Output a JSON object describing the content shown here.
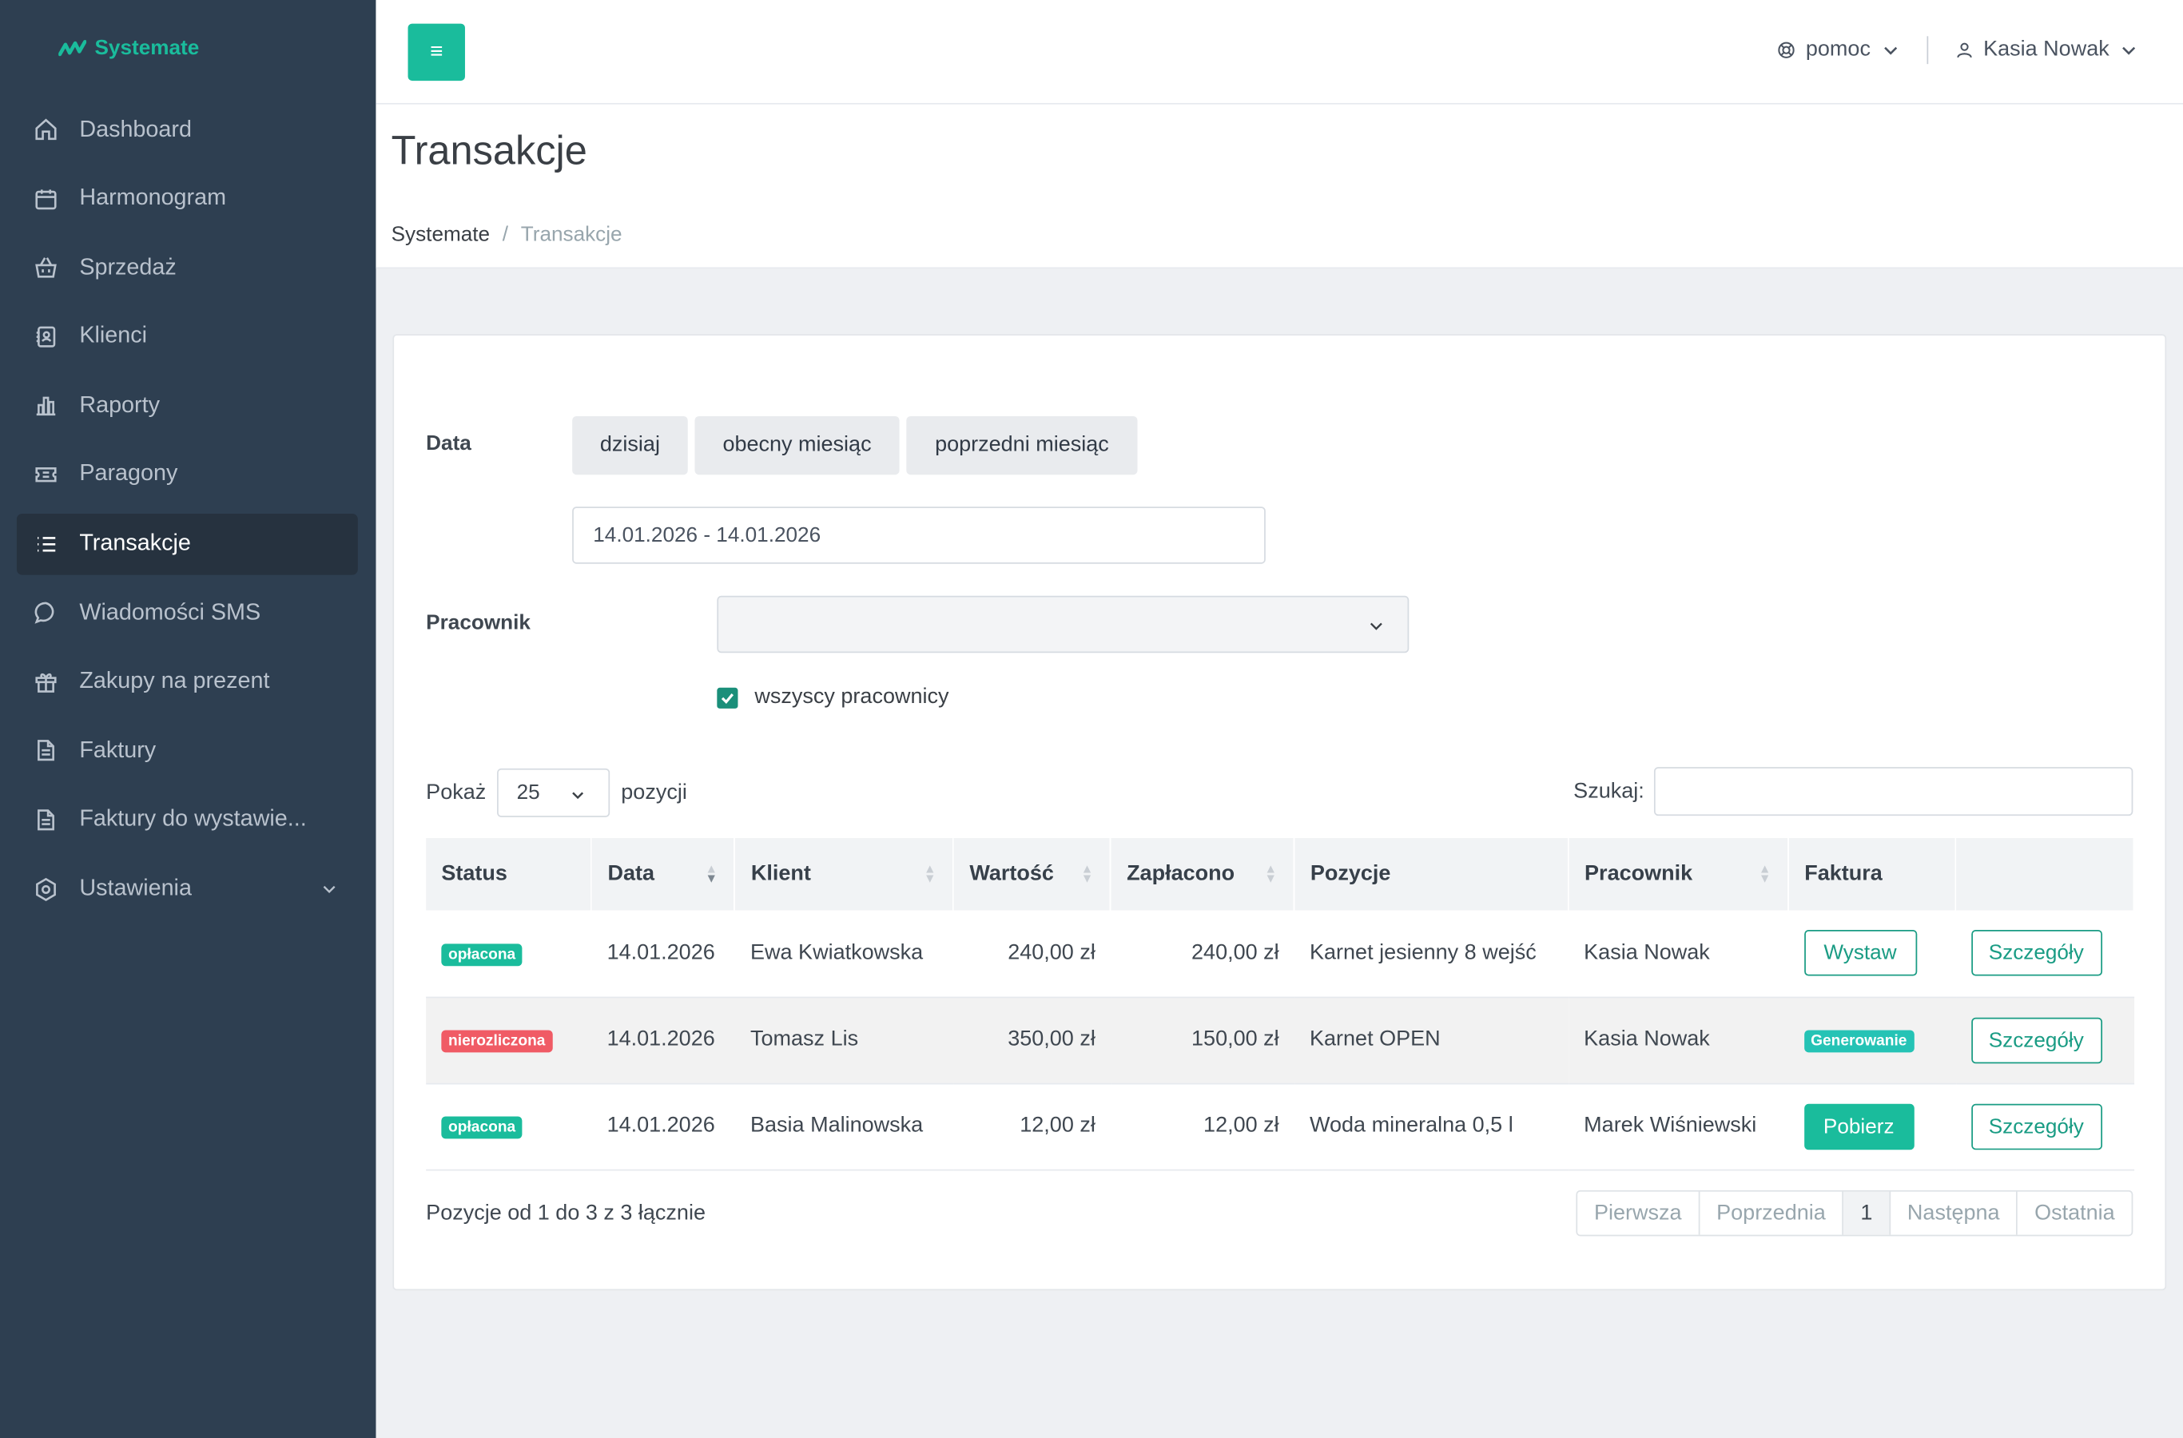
{
  "app": {
    "name": "Systemate"
  },
  "sidebar": {
    "items": [
      {
        "label": "Dashboard",
        "icon": "home-icon"
      },
      {
        "label": "Harmonogram",
        "icon": "calendar-icon"
      },
      {
        "label": "Sprzedaż",
        "icon": "basket-icon"
      },
      {
        "label": "Klienci",
        "icon": "contacts-icon"
      },
      {
        "label": "Raporty",
        "icon": "bar-chart-icon"
      },
      {
        "label": "Paragony",
        "icon": "ticket-icon"
      },
      {
        "label": "Transakcje",
        "icon": "list-icon",
        "active": true
      },
      {
        "label": "Wiadomości SMS",
        "icon": "chat-icon"
      },
      {
        "label": "Zakupy na prezent",
        "icon": "gift-icon"
      },
      {
        "label": "Faktury",
        "icon": "document-icon"
      },
      {
        "label": "Faktury do wystawie...",
        "icon": "document-icon"
      },
      {
        "label": "Ustawienia",
        "icon": "settings-icon"
      }
    ]
  },
  "topbar": {
    "menu_glyph": "≡",
    "help_label": "pomoc",
    "user_name": "Kasia Nowak"
  },
  "page": {
    "title": "Transakcje",
    "breadcrumb": {
      "root": "Systemate",
      "divider": "/",
      "current": "Transakcje"
    }
  },
  "filters": {
    "date_label": "Data",
    "quick_ranges": [
      "dzisiaj",
      "obecny miesiąc",
      "poprzedni miesiąc"
    ],
    "date_range": "14.01.2026 - 14.01.2026",
    "employee_label": "Pracownik",
    "employee_value": "",
    "all_employees_label": "wszyscy pracownicy",
    "all_employees_checked": true
  },
  "table_controls": {
    "show_label": "Pokaż",
    "page_length": "25",
    "entries_label": "pozycji",
    "search_label": "Szukaj:",
    "search_value": ""
  },
  "table": {
    "columns": [
      "Status",
      "Data",
      "Klient",
      "Wartość",
      "Zapłacono",
      "Pozycje",
      "Pracownik",
      "Faktura",
      ""
    ],
    "rows": [
      {
        "status": "opłacona",
        "status_color": "#1abc9c",
        "date": "14.01.2026",
        "client": "Ewa Kwiatkowska",
        "value": "240,00 zł",
        "paid": "240,00 zł",
        "items": "Karnet jesienny 8 wejść",
        "employee": "Kasia Nowak",
        "invoice": "Wystaw",
        "invoice_kind": "outline",
        "details": "Szczegóły"
      },
      {
        "status": "nierozliczona",
        "status_color": "#f05b65",
        "date": "14.01.2026",
        "client": "Tomasz Lis",
        "value": "350,00 zł",
        "paid": "150,00 zł",
        "items": "Karnet OPEN",
        "employee": "Kasia Nowak",
        "invoice": "Generowanie",
        "invoice_kind": "badge",
        "details": "Szczegóły"
      },
      {
        "status": "opłacona",
        "status_color": "#1abc9c",
        "date": "14.01.2026",
        "client": "Basia Malinowska",
        "value": "12,00 zł",
        "paid": "12,00 zł",
        "items": "Woda mineralna 0,5 l",
        "employee": "Marek Wiśniewski",
        "invoice": "Pobierz",
        "invoice_kind": "solid",
        "details": "Szczegóły"
      }
    ]
  },
  "footer": {
    "info": "Pozycje od 1 do 3 z 3 łącznie",
    "pagination": {
      "first": "Pierwsza",
      "prev": "Poprzednia",
      "current": "1",
      "next": "Następna",
      "last": "Ostatnia"
    }
  },
  "colors": {
    "accent": "#1abc9c",
    "sidebar": "#2e3f51",
    "danger": "#f05b65"
  }
}
